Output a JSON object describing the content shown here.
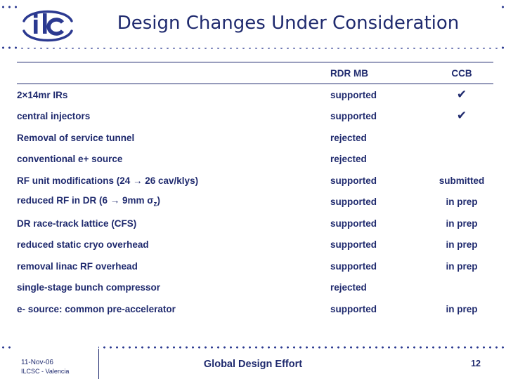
{
  "header": {
    "title": "Design Changes Under Consideration",
    "logo_name": "ilc-logo"
  },
  "table": {
    "columns": [
      "",
      "RDR MB",
      "CCB"
    ],
    "check_glyph": "✔",
    "rows": [
      {
        "item": "2×14mr IRs",
        "item_html": "2&#215;14mr IRs",
        "rdr": "supported",
        "ccb": "✔",
        "ccb_is_check": true
      },
      {
        "item": "central injectors",
        "item_html": "central injectors",
        "rdr": "supported",
        "ccb": "✔",
        "ccb_is_check": true
      },
      {
        "item": "Removal of service tunnel",
        "item_html": "Removal of service tunnel",
        "rdr": "rejected",
        "ccb": "",
        "ccb_is_check": false
      },
      {
        "item": "conventional e+ source",
        "item_html": "conventional e+ source",
        "rdr": "rejected",
        "ccb": "",
        "ccb_is_check": false
      },
      {
        "item": "RF unit modifications (24 → 26 cav/klys)",
        "item_html": "RF unit modifications (24 &#8594; 26 cav/klys)",
        "rdr": "supported",
        "ccb": "submitted",
        "ccb_is_check": false
      },
      {
        "item": "reduced RF in DR (6 → 9mm σz)",
        "item_html": "reduced RF in DR (6 &#8594; 9mm &#963;<span class=\"sub\">z</span>)",
        "rdr": "supported",
        "ccb": "in prep",
        "ccb_is_check": false
      },
      {
        "item": "DR race-track lattice (CFS)",
        "item_html": "DR race-track lattice (CFS)",
        "rdr": "supported",
        "ccb": "in prep",
        "ccb_is_check": false
      },
      {
        "item": "reduced static cryo overhead",
        "item_html": "reduced static cryo overhead",
        "rdr": "supported",
        "ccb": "in prep",
        "ccb_is_check": false
      },
      {
        "item": "removal linac RF overhead",
        "item_html": "removal linac RF overhead",
        "rdr": "supported",
        "ccb": "in prep",
        "ccb_is_check": false
      },
      {
        "item": "single-stage bunch compressor",
        "item_html": "single-stage bunch compressor",
        "rdr": "rejected",
        "ccb": "",
        "ccb_is_check": false
      },
      {
        "item": "e- source: common pre-accelerator",
        "item_html": "e- source: common pre-accelerator",
        "rdr": "supported",
        "ccb": "in prep",
        "ccb_is_check": false
      }
    ]
  },
  "footer": {
    "date": "11-Nov-06",
    "conference": "ILCSC - Valencia",
    "center": "Global Design Effort",
    "page_number": "12"
  },
  "colors": {
    "primary": "#1f2a6e",
    "dots": "#2b3990",
    "background": "#ffffff"
  }
}
